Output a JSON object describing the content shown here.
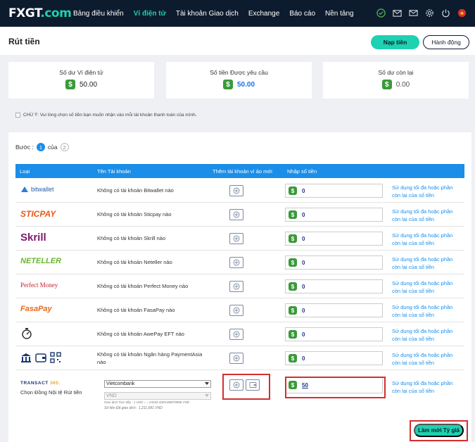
{
  "nav": {
    "logo_main": "FXGT",
    "logo_dot": ".com",
    "links": [
      "Bảng điều khiển",
      "Ví điện tử",
      "Tài khoản Giao dịch",
      "Exchange",
      "Báo cáo",
      "Nền tảng"
    ],
    "active_index": 1,
    "icons": [
      "shield-check-icon",
      "mail-icon",
      "envelope-icon",
      "gear-icon",
      "power-icon",
      "flag-icon"
    ]
  },
  "page": {
    "title": "Rút tiền",
    "deposit_label": "Nạp tiền",
    "action_label": "Hành động"
  },
  "cards": [
    {
      "label": "Số dư Ví điện tử",
      "value": "50.00"
    },
    {
      "label": "Số tiền Được yêu cầu",
      "value": "50.00"
    },
    {
      "label": "Số dư còn lại",
      "value": "0.00"
    }
  ],
  "note": "CHÚ Ý: Vui lòng chọn số tiền bạn muốn nhận vào mỗi tài khoản thanh toán của mình.",
  "steps": {
    "label": "Bước :",
    "current": "1",
    "of": "của",
    "total": "2"
  },
  "table": {
    "headers": [
      "Loại",
      "Tên Tài khoản",
      "Thêm tài khoản ví ảo mới",
      "Nhập số tiền"
    ],
    "rows": [
      {
        "brand": "bitwallet",
        "name": "Không có tài khoản Bitwallet nào",
        "amount": "0",
        "link": "Sử dụng tối đa hoặc phần còn lại của số tiền"
      },
      {
        "brand": "STICPAY",
        "name": "Không có tài khoản Sticpay nào",
        "amount": "0",
        "link": "Sử dụng tối đa hoặc phần còn lại của số tiền"
      },
      {
        "brand": "Skrill",
        "name": "Không có tài khoản Skrill nào",
        "amount": "0",
        "link": "Sử dụng tối đa hoặc phần còn lại của số tiền"
      },
      {
        "brand": "NETELLER",
        "name": "Không có tài khoản Neteller nào",
        "amount": "0",
        "link": "Sử dụng tối đa hoặc phần còn lại của số tiền"
      },
      {
        "brand": "Perfect Money",
        "name": "Không có tài khoản Perfect Money nào",
        "amount": "0",
        "link": "Sử dụng tối đa hoặc phần còn lại của số tiền"
      },
      {
        "brand": "FasaPay",
        "name": "Không có tài khoản FasaPay nào",
        "amount": "0",
        "link": "Sử dụng tối đa hoặc phần còn lại của số tiền"
      },
      {
        "brand": "AwePay",
        "name": "Không có tài khoản AwePay EFT nào",
        "amount": "0",
        "link": "Sử dụng tối đa hoặc phần còn lại của số tiền"
      },
      {
        "brand": "PaymentAsia",
        "name": "Không có tài khoản Ngân hàng PaymentAsia nào",
        "amount": "0",
        "link": "Sử dụng tối đa hoặc phần còn lại của số tiền"
      }
    ],
    "transact": {
      "brand_a": "TRANSACT",
      "brand_b": "365.",
      "label": "Chọn Đồng Nội tệ Rút tiền",
      "bank_select": "Vietcombank",
      "currency_select": "VND",
      "rate_text": "Giao dịch Trực tiếp : 1 USD = ~ 24233.4003198879998 VND",
      "amount_text": "Số tiền Đã giao dịch : 1,211,681 VND",
      "amount": "50",
      "link": "Sử dụng tối đa hoặc phần còn lại của số tiền"
    }
  },
  "refresh_label": "Làm mới Tỷ giá"
}
